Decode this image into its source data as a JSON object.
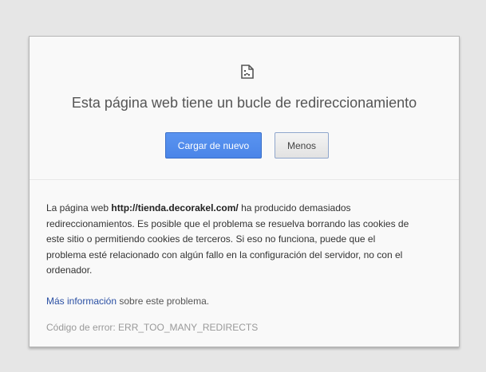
{
  "title": "Esta página web tiene un bucle de redireccionamiento",
  "buttons": {
    "reload": "Cargar de nuevo",
    "less": "Menos"
  },
  "details": {
    "prefix": "La página web ",
    "url": "http://tienda.decorakel.com/",
    "line1_suffix": " ha producido demasiados",
    "line2": "redireccionamientos. Es posible que el problema se resuelva borrando las cookies de",
    "line3": "este sitio o permitiendo cookies de terceros. Si eso no funciona, puede que el",
    "line4": "problema esté relacionado con algún fallo en la configuración del servidor, no con el",
    "line5": "ordenador."
  },
  "more": {
    "link": "Más información",
    "suffix": " sobre este problema."
  },
  "error_code": "Código de error: ERR_TOO_MANY_REDIRECTS",
  "icon": "sad-page-icon"
}
